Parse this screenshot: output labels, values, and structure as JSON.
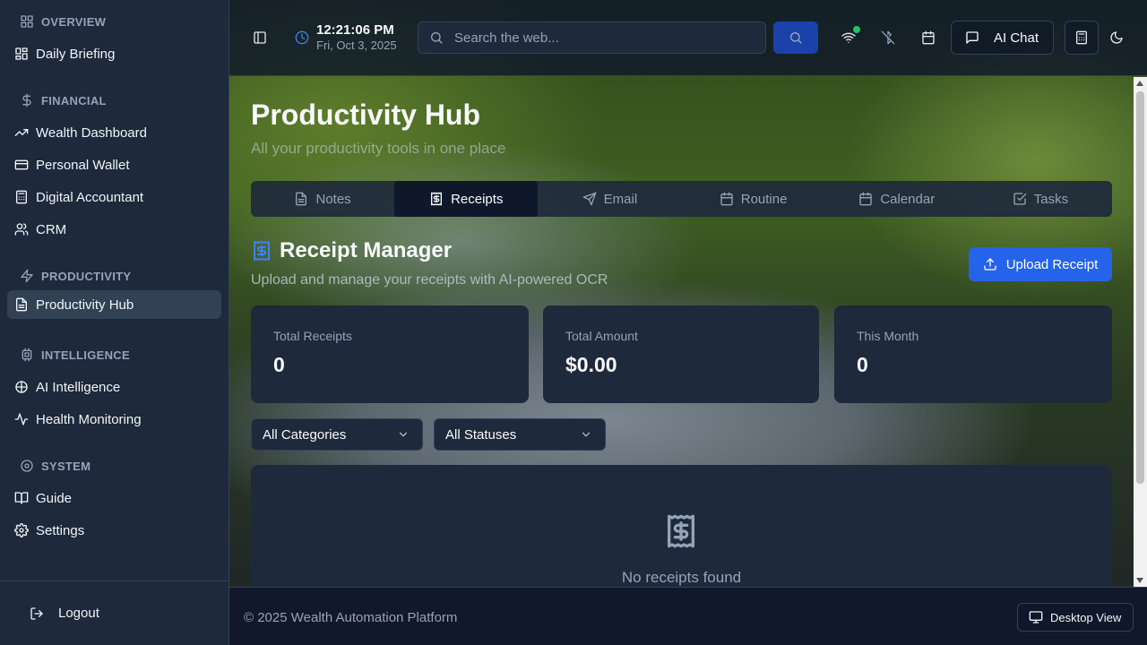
{
  "sidebar": {
    "sections": [
      {
        "title": "OVERVIEW",
        "icon": "grid-icon",
        "items": [
          {
            "label": "Daily Briefing",
            "icon": "dashboard-icon"
          }
        ]
      },
      {
        "title": "FINANCIAL",
        "icon": "dollar-icon",
        "items": [
          {
            "label": "Wealth Dashboard",
            "icon": "trending-up-icon"
          },
          {
            "label": "Personal Wallet",
            "icon": "wallet-icon"
          },
          {
            "label": "Digital Accountant",
            "icon": "calculator-icon"
          },
          {
            "label": "CRM",
            "icon": "users-icon"
          }
        ]
      },
      {
        "title": "PRODUCTIVITY",
        "icon": "zap-icon",
        "items": [
          {
            "label": "Productivity Hub",
            "icon": "file-text-icon",
            "active": true
          }
        ]
      },
      {
        "title": "INTELLIGENCE",
        "icon": "cpu-icon",
        "items": [
          {
            "label": "AI Intelligence",
            "icon": "brain-icon"
          },
          {
            "label": "Health Monitoring",
            "icon": "activity-icon"
          }
        ]
      },
      {
        "title": "SYSTEM",
        "icon": "settings-circle-icon",
        "items": [
          {
            "label": "Guide",
            "icon": "book-icon"
          },
          {
            "label": "Settings",
            "icon": "gear-icon"
          }
        ]
      }
    ],
    "logout_label": "Logout"
  },
  "topbar": {
    "time": "12:21:06 PM",
    "date": "Fri, Oct 3, 2025",
    "search_placeholder": "Search the web...",
    "ai_chat_label": "AI Chat"
  },
  "page": {
    "title": "Productivity Hub",
    "subtitle": "All your productivity tools in one place"
  },
  "tabs": [
    {
      "label": "Notes",
      "icon": "file-icon"
    },
    {
      "label": "Receipts",
      "icon": "receipt-icon",
      "active": true
    },
    {
      "label": "Email",
      "icon": "send-icon"
    },
    {
      "label": "Routine",
      "icon": "calendar-icon"
    },
    {
      "label": "Calendar",
      "icon": "calendar-icon"
    },
    {
      "label": "Tasks",
      "icon": "check-square-icon"
    }
  ],
  "receipts": {
    "title": "Receipt Manager",
    "subtitle": "Upload and manage your receipts with AI-powered OCR",
    "upload_label": "Upload Receipt",
    "stats": [
      {
        "label": "Total Receipts",
        "value": "0"
      },
      {
        "label": "Total Amount",
        "value": "$0.00"
      },
      {
        "label": "This Month",
        "value": "0"
      }
    ],
    "filters": {
      "category": "All Categories",
      "status": "All Statuses"
    },
    "empty_text": "No receipts found"
  },
  "footer": {
    "copyright": "© 2025 Wealth Automation Platform",
    "view_label": "Desktop View"
  },
  "colors": {
    "accent": "#2563eb",
    "sidebar": "#1e293b",
    "online": "#22c55e"
  }
}
